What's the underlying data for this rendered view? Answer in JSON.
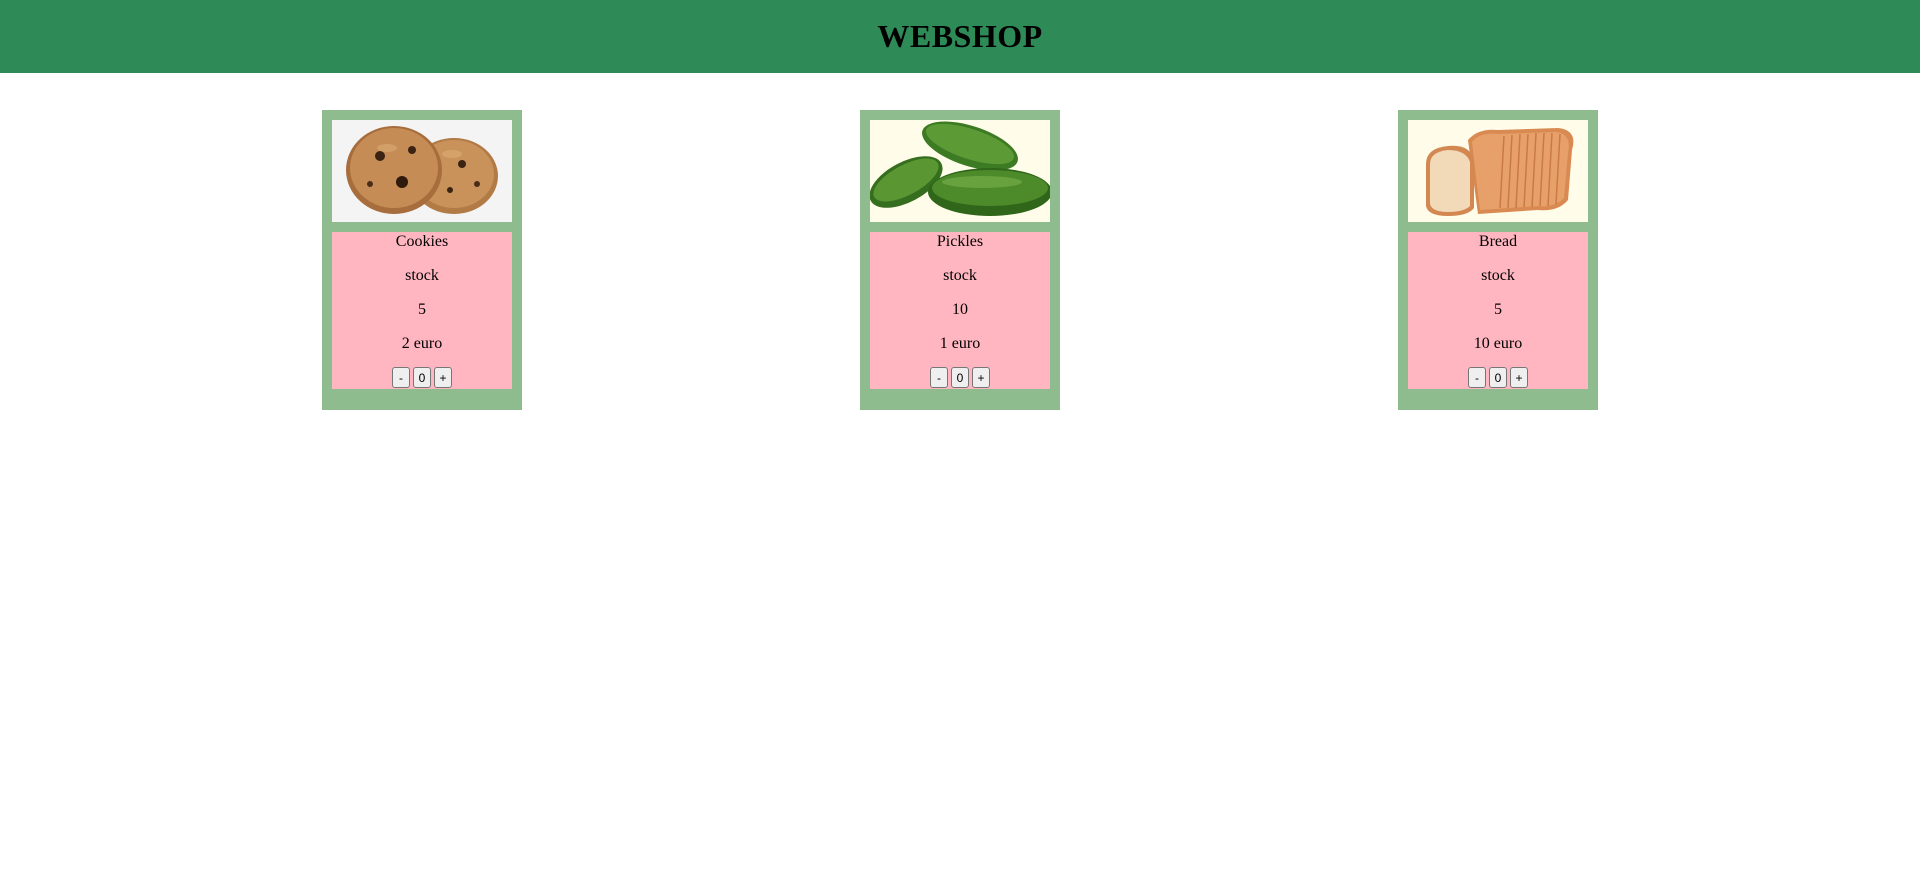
{
  "header": {
    "title": "WEBSHOP",
    "bg_color": "#2e8b57"
  },
  "colors": {
    "card_bg": "#8fbc8f",
    "info_bg": "#ffb6c1"
  },
  "products": [
    {
      "name": "Cookies",
      "stock_label": "stock",
      "stock": "5",
      "price": "2 euro",
      "minus": "-",
      "qty": "0",
      "plus": "+",
      "image": "cookies-image"
    },
    {
      "name": "Pickles",
      "stock_label": "stock",
      "stock": "10",
      "price": "1 euro",
      "minus": "-",
      "qty": "0",
      "plus": "+",
      "image": "pickles-image"
    },
    {
      "name": "Bread",
      "stock_label": "stock",
      "stock": "5",
      "price": "10 euro",
      "minus": "-",
      "qty": "0",
      "plus": "+",
      "image": "bread-image"
    }
  ]
}
